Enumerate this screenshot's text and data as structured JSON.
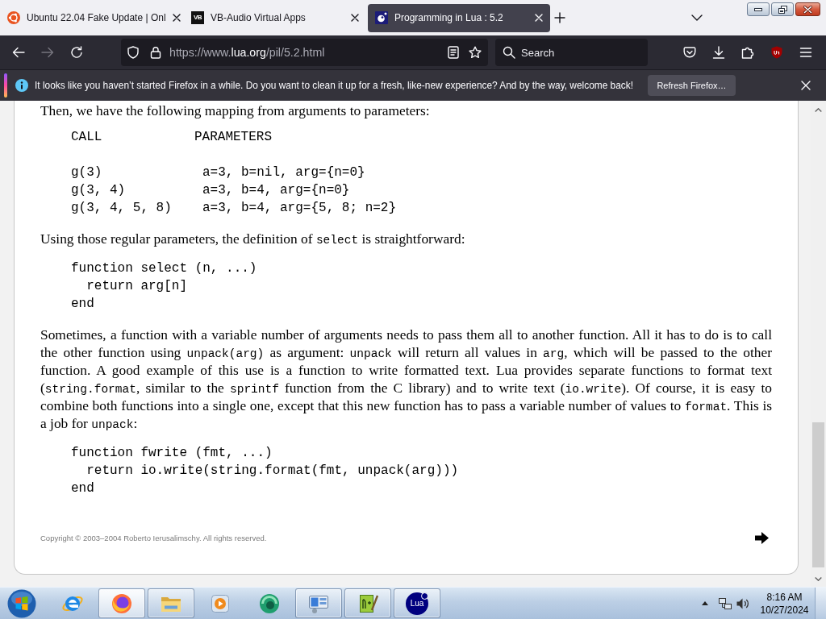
{
  "browser": {
    "tabs": [
      {
        "title": "Ubuntu 22.04 Fake Update | Onl",
        "selected": false
      },
      {
        "title": "VB-Audio Virtual Apps",
        "badge": "VB",
        "selected": false
      },
      {
        "title": "Programming in Lua : 5.2",
        "selected": true
      }
    ],
    "toolbar": {
      "url_parts": [
        "https://www.",
        "lua.org",
        "/pil/5.2.html"
      ],
      "search": {
        "placeholder": "Search"
      }
    },
    "notification": {
      "message": "It looks like you haven’t started Firefox in a while. Do you want to clean it up for a fresh, like-new experience? And by the way, welcome back!",
      "button": "Refresh Firefox…"
    }
  },
  "page": {
    "blocks": [
      {
        "kind": "paragraph",
        "segments": [
          {
            "kind": "text",
            "text": "Then, we have the following mapping from arguments to parameters:"
          }
        ]
      },
      {
        "kind": "mapping",
        "headers": [
          "CALL",
          "PARAMETERS"
        ],
        "rows": [
          {
            "call": "g(3)",
            "parameters": "a=3, b=nil, arg={n=0}"
          },
          {
            "call": "g(3, 4)",
            "parameters": "a=3, b=4, arg={n=0}"
          },
          {
            "call": "g(3, 4, 5, 8)",
            "parameters": "a=3, b=4, arg={5, 8; n=2}"
          }
        ]
      },
      {
        "kind": "paragraph",
        "segments": [
          {
            "kind": "text",
            "text": "Using those regular parameters, the definition of "
          },
          {
            "kind": "code",
            "text": "select"
          },
          {
            "kind": "text",
            "text": " is straightforward:"
          }
        ]
      },
      {
        "kind": "code",
        "lines": [
          "function select (n, ...)",
          "  return arg[n]",
          "end"
        ]
      },
      {
        "kind": "paragraph",
        "segments": [
          {
            "kind": "text",
            "text": "Sometimes, a function with a variable number of arguments needs to pass them all to another function. All it has to do is to call the other function using "
          },
          {
            "kind": "code",
            "text": "unpack(arg)"
          },
          {
            "kind": "text",
            "text": " as argument: "
          },
          {
            "kind": "code",
            "text": "unpack"
          },
          {
            "kind": "text",
            "text": " will return all values in "
          },
          {
            "kind": "code",
            "text": "arg"
          },
          {
            "kind": "text",
            "text": ", which will be passed to the other function. A good example of this use is a function to write formatted text. Lua provides separate functions to format text ("
          },
          {
            "kind": "code",
            "text": "string.format"
          },
          {
            "kind": "text",
            "text": ", similar to the "
          },
          {
            "kind": "code",
            "text": "sprintf"
          },
          {
            "kind": "text",
            "text": " function from the C library) and to write text ("
          },
          {
            "kind": "code",
            "text": "io.write"
          },
          {
            "kind": "text",
            "text": "). Of course, it is easy to combine both functions into a single one, except that this new function has to pass a variable number of values to "
          },
          {
            "kind": "code",
            "text": "format"
          },
          {
            "kind": "text",
            "text": ". This is a job for "
          },
          {
            "kind": "code",
            "text": "unpack"
          },
          {
            "kind": "text",
            "text": ":"
          }
        ]
      },
      {
        "kind": "code",
        "lines": [
          "function fwrite (fmt, ...)",
          "  return io.write(string.format(fmt, unpack(arg)))",
          "end"
        ]
      }
    ],
    "copyright": "Copyright © 2003–2004 Roberto Ierusalimschy. All rights reserved."
  },
  "taskbar": {
    "items": [
      {
        "running": false,
        "active": false
      },
      {
        "running": true,
        "active": true
      },
      {
        "running": true,
        "active": false
      },
      {
        "running": false,
        "active": false
      },
      {
        "running": false,
        "active": false
      },
      {
        "running": true,
        "active": false
      },
      {
        "running": true,
        "active": false
      },
      {
        "label": "Lua",
        "running": true,
        "active": false
      }
    ],
    "clock": {
      "time": "8:16 AM",
      "date": "10/27/2024"
    }
  }
}
